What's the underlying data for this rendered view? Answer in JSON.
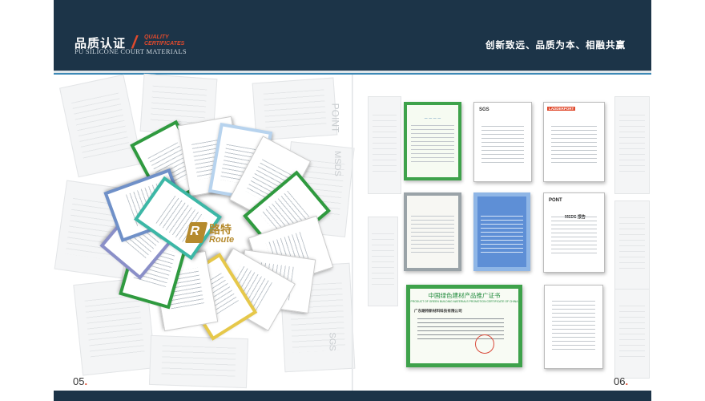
{
  "header": {
    "title_cn": "品质认证",
    "title_en_lines": [
      "QUALITY",
      "CERTIFICATES"
    ],
    "subtitle_en": "PU SILICONE COURT MATERIALS",
    "slogan": "创新致远、品质为本、相融共赢"
  },
  "brand": {
    "mark": "R",
    "name_cn": "路特",
    "name_en": "Route"
  },
  "left_page": {
    "page_number": "05",
    "background_text": [
      "POINT",
      "MSDS",
      "SGS"
    ]
  },
  "right_page": {
    "page_number": "06",
    "card_labels": {
      "sgs": "SGS",
      "ladder": "LADDERPORT",
      "point": "PONT",
      "msds": "MSDS 报告"
    },
    "big_certificate": {
      "title_cn": "中国绿色建材产品推广证书",
      "title_en": "PRODUCT OF GREEN BUILDING MATERIALS PROMOTION CERTIFICATE OF CHINA",
      "company": "广东路特新材料科技有限公司"
    }
  },
  "colors": {
    "header_bg": "#1c3448",
    "accent_red": "#e04a2d",
    "rule_blue": "#3d89b6",
    "brand_gold": "#b58a2d",
    "cert_green": "#3ea24b"
  }
}
